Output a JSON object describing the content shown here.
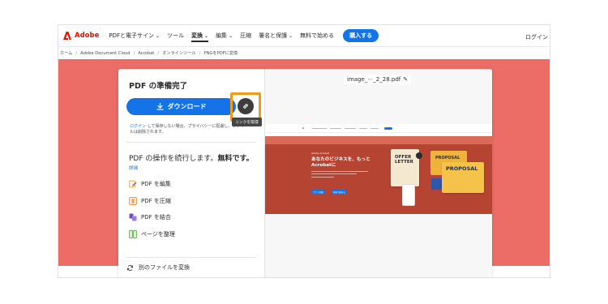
{
  "nav": {
    "brand": "Adobe",
    "items": [
      "PDFと電子サイン",
      "ツール",
      "変換",
      "編集",
      "圧縮",
      "署名と保護",
      "無料で始める"
    ],
    "buy": "購入する",
    "login": "ログイン"
  },
  "breadcrumb": [
    "ホーム",
    "Adobe Document Cloud",
    "Acrobat",
    "オンラインツール",
    "PNGをPDFに変換"
  ],
  "panel": {
    "title": "PDF の準備完了",
    "download": "ダウンロード",
    "tooltip": "リンクを取得",
    "note_link": "ログイン",
    "note_text": " して保存しない場合、プライバシーに配慮し、ファイルは削除されます。",
    "continue_text": "PDF の操作を続行します。",
    "continue_bold": "無料です。",
    "detail": "詳細",
    "tools": [
      "PDF を編集",
      "PDF を圧縮",
      "PDF を結合",
      "ページを整理"
    ],
    "other": "別のファイルを変換"
  },
  "preview": {
    "filename": "image_⋯_2_28.pdf",
    "tag": "Adobe Acrobat",
    "headline": "あなたのビジネスを、もっとAcrobatに",
    "btn1": "プラン詳細",
    "btn2": "無料で始める",
    "offer": "OFFER LETTER",
    "proposal_a": "PROPOSAL",
    "proposal_b": "PROPOSAL"
  },
  "colors": {
    "accent": "#1473e6",
    "hero": "#ec6c66",
    "highlight": "#f29b1b",
    "brand": "#eb1000"
  }
}
